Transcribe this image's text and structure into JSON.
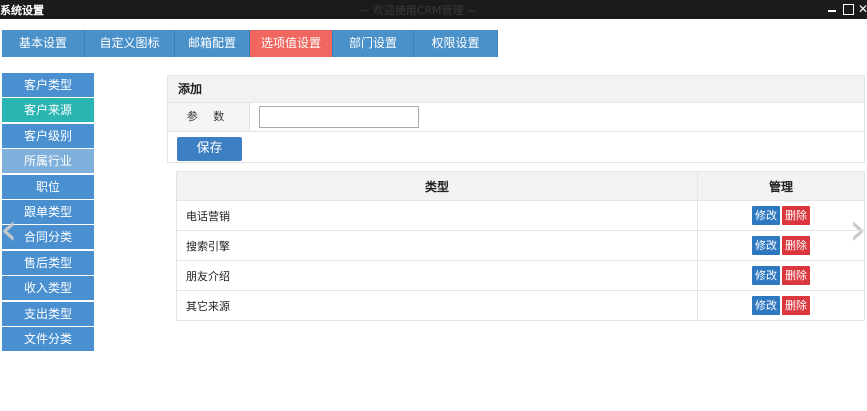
{
  "window": {
    "title": "系统设置",
    "center_title": "~ 欢迎使用CRM管理 ~",
    "minimize_label": "",
    "maximize_label": "",
    "close_label": "✕"
  },
  "tabs": [
    {
      "label": "基本设置"
    },
    {
      "label": "自定义图标"
    },
    {
      "label": "邮箱配置"
    },
    {
      "label": "选项值设置"
    },
    {
      "label": "部门设置"
    },
    {
      "label": "权限设置"
    }
  ],
  "sidebar": {
    "items": [
      {
        "label": "客户类型"
      },
      {
        "label": "客户来源"
      },
      {
        "label": "客户级别"
      },
      {
        "label": "所属行业"
      },
      {
        "label": "职位"
      },
      {
        "label": "跟单类型"
      },
      {
        "label": "合同分类"
      },
      {
        "label": "售后类型"
      },
      {
        "label": "收入类型"
      },
      {
        "label": "支出类型"
      },
      {
        "label": "文件分类"
      }
    ]
  },
  "add_panel": {
    "heading": "添加",
    "param_label": "参 数",
    "param_value": "",
    "save_label": "保存"
  },
  "table": {
    "headers": {
      "type": "类型",
      "manage": "管理"
    },
    "rows": [
      {
        "type": "电话营销",
        "edit": "修改",
        "delete": "删除"
      },
      {
        "type": "搜索引擎",
        "edit": "修改",
        "delete": "删除"
      },
      {
        "type": "朋友介绍",
        "edit": "修改",
        "delete": "删除"
      },
      {
        "type": "其它来源",
        "edit": "修改",
        "delete": "删除"
      }
    ]
  },
  "nav_arrows": {
    "left": "‹",
    "right": "›"
  },
  "colors": {
    "tab": "#4a90c9",
    "tab_active": "#f0675f",
    "sidebar": "#4a90d0",
    "sidebar_active": "#2bb5b2",
    "edit_button": "#2e78c0",
    "delete_button": "#d9363e"
  }
}
